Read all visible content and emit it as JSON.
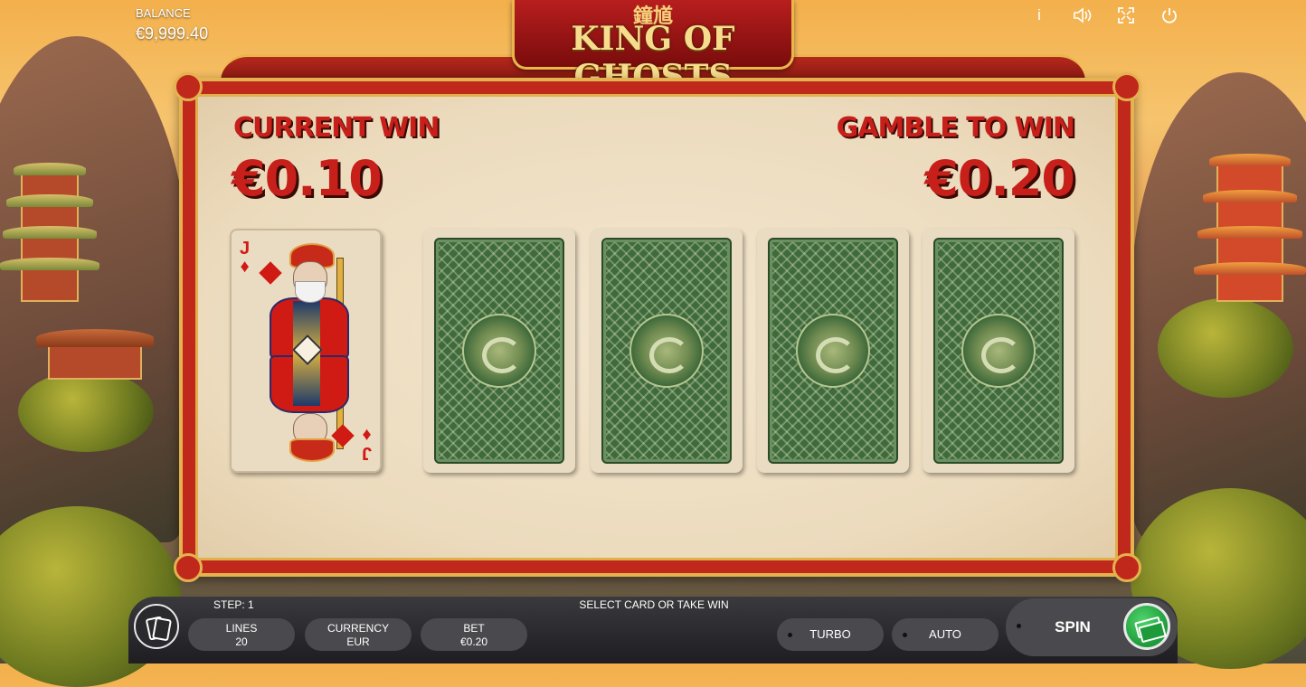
{
  "header": {
    "balance_label": "BALANCE",
    "balance_value": "€9,999.40",
    "logo_chinese": "鐘馗",
    "logo_text": "KING OF GHOSTS",
    "icons": [
      "info-icon",
      "sound-icon",
      "fullscreen-icon",
      "power-icon"
    ],
    "icon_glyphs": {
      "info": "i",
      "sound": "◁))",
      "fullscreen": "⛶",
      "power": "⏻"
    }
  },
  "gamble": {
    "current_win_label": "CURRENT WIN",
    "current_win_value": "€0.10",
    "gamble_to_win_label": "GAMBLE TO WIN",
    "gamble_to_win_value": "€0.20",
    "dealer_card": {
      "rank": "J",
      "suit": "diamonds",
      "suit_glyph": "♦"
    },
    "face_down_cards": 4
  },
  "controls": {
    "step_label": "STEP: 1",
    "status_text": "SELECT CARD OR TAKE WIN",
    "lines_label": "LINES",
    "lines_value": "20",
    "currency_label": "CURRENCY",
    "currency_value": "EUR",
    "bet_label": "BET",
    "bet_value": "€0.20",
    "turbo_label": "TURBO",
    "auto_label": "AUTO",
    "spin_label": "SPIN"
  },
  "colors": {
    "win_text": "#c71f1a",
    "frame_red": "#c0281c",
    "frame_gold": "#e4b24e",
    "card_back_green": "#3f6a3c",
    "spin_green": "#1e9a3a"
  }
}
